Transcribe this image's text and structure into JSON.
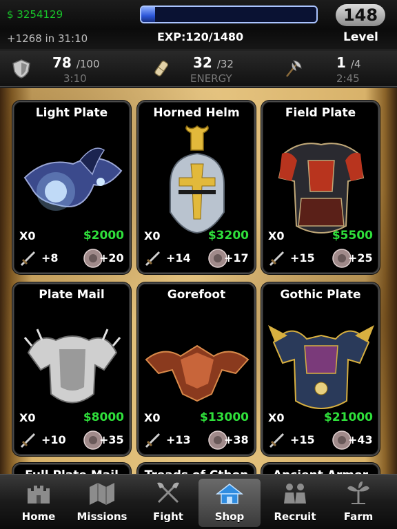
{
  "header": {
    "cash": "$ 3254129",
    "cash_timer": "+1268 in 31:10",
    "exp_label": "EXP:120/1480",
    "exp_fraction": 0.08,
    "level_value": "148",
    "level_label": "Level"
  },
  "stats": {
    "health": {
      "value": "78",
      "max": "/100",
      "timer": "3:10",
      "icon": "shield-icon"
    },
    "energy": {
      "value": "32",
      "max": "/32",
      "timer": "ENERGY",
      "icon": "scroll-icon"
    },
    "stamina": {
      "value": "1",
      "max": "/4",
      "timer": "2:45",
      "icon": "axe-icon"
    }
  },
  "items": [
    {
      "name": "Light Plate",
      "owned": "X0",
      "price": "$2000",
      "attack": "+8",
      "defense": "+20",
      "art": "light-plate-icon"
    },
    {
      "name": "Horned Helm",
      "owned": "X0",
      "price": "$3200",
      "attack": "+14",
      "defense": "+17",
      "art": "horned-helm-icon"
    },
    {
      "name": "Field Plate",
      "owned": "X0",
      "price": "$5500",
      "attack": "+15",
      "defense": "+25",
      "art": "field-plate-icon"
    },
    {
      "name": "Plate Mail",
      "owned": "X0",
      "price": "$8000",
      "attack": "+10",
      "defense": "+35",
      "art": "plate-mail-icon"
    },
    {
      "name": "Gorefoot",
      "owned": "X0",
      "price": "$13000",
      "attack": "+13",
      "defense": "+38",
      "art": "gorefoot-icon"
    },
    {
      "name": "Gothic Plate",
      "owned": "X0",
      "price": "$21000",
      "attack": "+15",
      "defense": "+43",
      "art": "gothic-plate-icon"
    },
    {
      "name": "Full Plate Mail"
    },
    {
      "name": "Treads of Cthon"
    },
    {
      "name": "Ancient Armor"
    }
  ],
  "nav": [
    {
      "label": "Home",
      "icon": "castle-icon"
    },
    {
      "label": "Missions",
      "icon": "map-icon"
    },
    {
      "label": "Fight",
      "icon": "crossed-axes-icon"
    },
    {
      "label": "Shop",
      "icon": "shop-house-icon",
      "active": true
    },
    {
      "label": "Recruit",
      "icon": "recruits-icon"
    },
    {
      "label": "Farm",
      "icon": "farm-plant-icon"
    }
  ],
  "colors": {
    "cash_green": "#18c52a",
    "price_green": "#2fe03b",
    "exp_blue": "#2b55d8",
    "parchment": "#e6c582"
  }
}
